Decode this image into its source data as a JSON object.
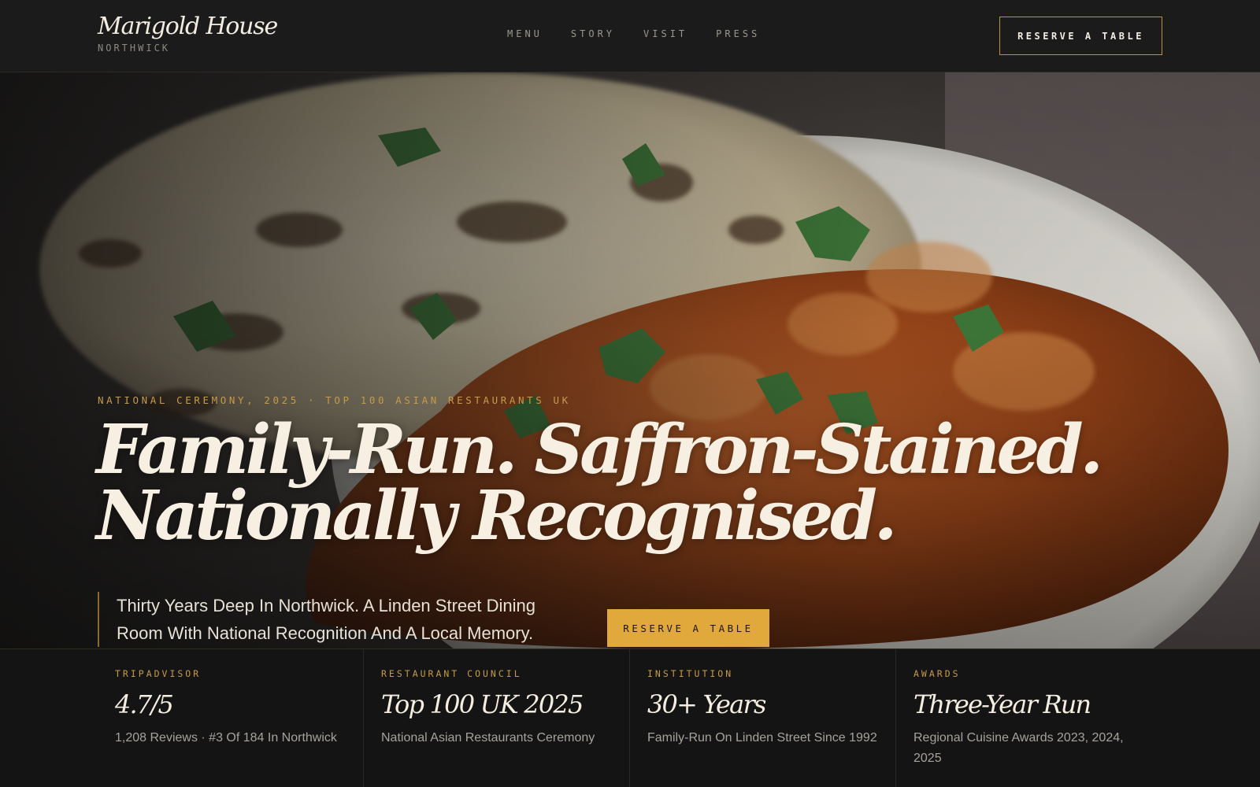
{
  "brand": {
    "name": "Marigold House",
    "location": "NORTHWICK"
  },
  "nav": {
    "items": [
      {
        "label": "MENU"
      },
      {
        "label": "STORY"
      },
      {
        "label": "VISIT"
      },
      {
        "label": "PRESS"
      }
    ],
    "reserve_label": "RESERVE A TABLE"
  },
  "hero": {
    "eyebrow": "NATIONAL CEREMONY, 2025 · TOP 100 ASIAN RESTAURANTS UK",
    "headline_line1": "Family-Run. Saffron-Stained.",
    "headline_line2": "Nationally Recognised.",
    "tagline": "Thirty Years Deep In Northwick. A Linden Street Dining Room With National Recognition And A Local Memory.",
    "reserve_label": "RESERVE A TABLE",
    "image_subject": "naan-and-curry-plate"
  },
  "stats": [
    {
      "label": "TRIPADVISOR",
      "value": "4.7/5",
      "desc": "1,208 Reviews · #3 Of 184 In Northwick"
    },
    {
      "label": "RESTAURANT COUNCIL",
      "value": "Top 100 UK 2025",
      "desc": "National Asian Restaurants Ceremony"
    },
    {
      "label": "INSTITUTION",
      "value": "30+ Years",
      "desc": "Family-Run On Linden Street Since 1992"
    },
    {
      "label": "AWARDS",
      "value": "Three-Year Run",
      "desc": "Regional Cuisine Awards 2023, 2024, 2025"
    }
  ],
  "colors": {
    "accent": "#e1a83b",
    "accent_muted": "#c59a4a",
    "background": "#141414",
    "header": "#1b1b1b",
    "text_light": "#f6efe2"
  }
}
